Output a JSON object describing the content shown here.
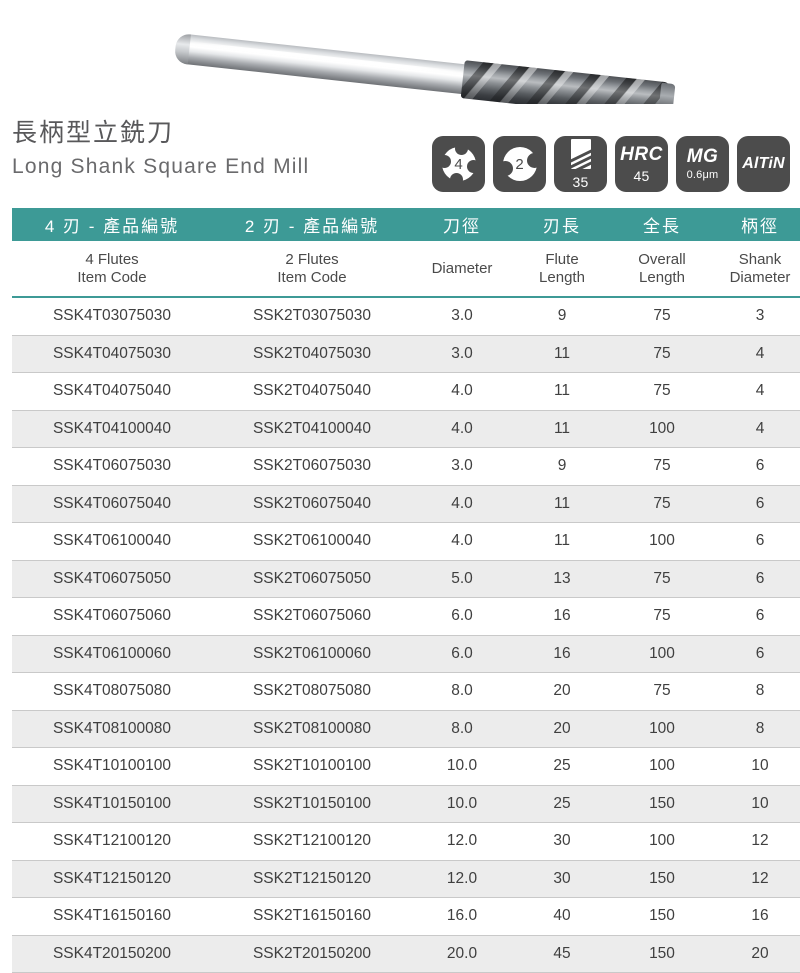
{
  "product": {
    "image_alt": "long-shank-square-end-mill",
    "title_cn": "長柄型立銑刀",
    "title_en": "Long Shank Square End Mill"
  },
  "badges": [
    {
      "name": "flutes-4-badge",
      "type": "flute-icon",
      "value": "4"
    },
    {
      "name": "flutes-2-badge",
      "type": "flute-icon",
      "value": "2"
    },
    {
      "name": "helix-angle-badge",
      "type": "helix-icon",
      "value": "35"
    },
    {
      "name": "hardness-badge",
      "type": "text",
      "main": "HRC",
      "sub": "45"
    },
    {
      "name": "coating-thickness-badge",
      "type": "text",
      "main": "MG",
      "sub": "0.6μm"
    },
    {
      "name": "coating-type-badge",
      "type": "altin",
      "main": "AlTiN"
    }
  ],
  "table": {
    "headers_cn": [
      "4 刃 - 產品編號",
      "2 刃 - 產品編號",
      "刀徑",
      "刃長",
      "全長",
      "柄徑"
    ],
    "headers_en": [
      "4 Flutes\nItem Code",
      "2 Flutes\nItem Code",
      "Diameter",
      "Flute\nLength",
      "Overall\nLength",
      "Shank\nDiameter"
    ],
    "rows": [
      [
        "SSK4T03075030",
        "SSK2T03075030",
        "3.0",
        "9",
        "75",
        "3"
      ],
      [
        "SSK4T04075030",
        "SSK2T04075030",
        "3.0",
        "11",
        "75",
        "4"
      ],
      [
        "SSK4T04075040",
        "SSK2T04075040",
        "4.0",
        "11",
        "75",
        "4"
      ],
      [
        "SSK4T04100040",
        "SSK2T04100040",
        "4.0",
        "11",
        "100",
        "4"
      ],
      [
        "SSK4T06075030",
        "SSK2T06075030",
        "3.0",
        "9",
        "75",
        "6"
      ],
      [
        "SSK4T06075040",
        "SSK2T06075040",
        "4.0",
        "11",
        "75",
        "6"
      ],
      [
        "SSK4T06100040",
        "SSK2T06100040",
        "4.0",
        "11",
        "100",
        "6"
      ],
      [
        "SSK4T06075050",
        "SSK2T06075050",
        "5.0",
        "13",
        "75",
        "6"
      ],
      [
        "SSK4T06075060",
        "SSK2T06075060",
        "6.0",
        "16",
        "75",
        "6"
      ],
      [
        "SSK4T06100060",
        "SSK2T06100060",
        "6.0",
        "16",
        "100",
        "6"
      ],
      [
        "SSK4T08075080",
        "SSK2T08075080",
        "8.0",
        "20",
        "75",
        "8"
      ],
      [
        "SSK4T08100080",
        "SSK2T08100080",
        "8.0",
        "20",
        "100",
        "8"
      ],
      [
        "SSK4T10100100",
        "SSK2T10100100",
        "10.0",
        "25",
        "100",
        "10"
      ],
      [
        "SSK4T10150100",
        "SSK2T10150100",
        "10.0",
        "25",
        "150",
        "10"
      ],
      [
        "SSK4T12100120",
        "SSK2T12100120",
        "12.0",
        "30",
        "100",
        "12"
      ],
      [
        "SSK4T12150120",
        "SSK2T12150120",
        "12.0",
        "30",
        "150",
        "12"
      ],
      [
        "SSK4T16150160",
        "SSK2T16150160",
        "16.0",
        "40",
        "150",
        "16"
      ],
      [
        "SSK4T20150200",
        "SSK2T20150200",
        "20.0",
        "45",
        "150",
        "20"
      ]
    ]
  },
  "colors": {
    "header_teal": "#3d9a96",
    "badge_gray": "#4c4c4c",
    "row_alt": "#ececec",
    "text": "#3f3f3f"
  }
}
